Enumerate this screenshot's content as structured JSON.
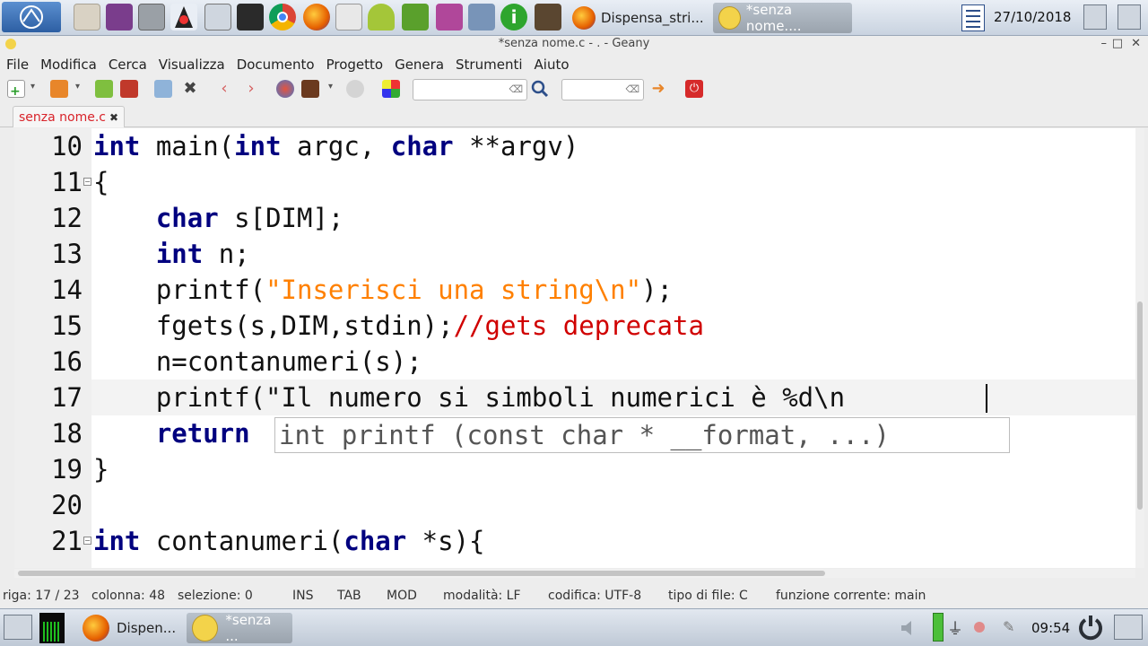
{
  "top_panel": {
    "launchers": [
      "start-menu-icon",
      "files-icon",
      "purple-app-icon",
      "terminal-app-icon",
      "java-icon",
      "camera-icon",
      "screen-icon",
      "chrome-icon",
      "firefox-icon",
      "mail-icon",
      "android-icon",
      "pen-icon",
      "media-icon",
      "network-icon",
      "info-icon",
      "stamp-icon"
    ],
    "tasks": [
      {
        "label": "Dispensa_stri...",
        "icon": "firefox-icon",
        "active": false
      },
      {
        "label": "*senza nome....",
        "icon": "geany-icon",
        "active": true
      }
    ],
    "date": "27/10/2018"
  },
  "window": {
    "title": "*senza nome.c - . - Geany"
  },
  "menu": {
    "items": [
      "File",
      "Modifica",
      "Cerca",
      "Visualizza",
      "Documento",
      "Progetto",
      "Genera",
      "Strumenti",
      "Aiuto"
    ]
  },
  "toolbar": {
    "search_value": "",
    "goto_value": ""
  },
  "tab": {
    "label": "senza nome.c",
    "close": "✖"
  },
  "editor": {
    "lines": [
      {
        "num": "10",
        "fold": "",
        "html": [
          [
            "kw",
            "int"
          ],
          [
            "ph",
            " main("
          ],
          [
            "kw",
            "int"
          ],
          [
            "ph",
            " argc, "
          ],
          [
            "kw",
            "char"
          ],
          [
            "ph",
            " **argv)"
          ]
        ]
      },
      {
        "num": "11",
        "fold": "−",
        "html": [
          [
            "ph",
            "{"
          ]
        ]
      },
      {
        "num": "12",
        "fold": "",
        "html": [
          [
            "ph",
            "    "
          ],
          [
            "kw",
            "char"
          ],
          [
            "ph",
            " s[DIM];"
          ]
        ]
      },
      {
        "num": "13",
        "fold": "",
        "html": [
          [
            "ph",
            "    "
          ],
          [
            "kw",
            "int"
          ],
          [
            "ph",
            " n;"
          ]
        ]
      },
      {
        "num": "14",
        "fold": "",
        "html": [
          [
            "ph",
            "    printf("
          ],
          [
            "str",
            "\"Inserisci una string\\n\""
          ],
          [
            "ph",
            ");"
          ]
        ]
      },
      {
        "num": "15",
        "fold": "",
        "html": [
          [
            "ph",
            "    fgets(s,DIM,stdin);"
          ],
          [
            "cm",
            "//gets deprecata"
          ]
        ]
      },
      {
        "num": "16",
        "fold": "",
        "html": [
          [
            "ph",
            "    n=contanumeri(s);"
          ]
        ]
      },
      {
        "num": "17",
        "fold": "",
        "html": [
          [
            "ph",
            "    printf(\"Il numero si simboli numerici è %d\\n"
          ]
        ]
      },
      {
        "num": "18",
        "fold": "",
        "html": [
          [
            "ph",
            "    "
          ],
          [
            "kw",
            "return"
          ]
        ]
      },
      {
        "num": "19",
        "fold": "",
        "html": [
          [
            "ph",
            "}"
          ]
        ]
      },
      {
        "num": "20",
        "fold": "",
        "html": [
          [
            "ph",
            ""
          ]
        ]
      },
      {
        "num": "21",
        "fold": "−",
        "html": [
          [
            "kw",
            "int"
          ],
          [
            "ph",
            " contanumeri("
          ],
          [
            "kw",
            "char"
          ],
          [
            "ph",
            " *s){"
          ]
        ]
      }
    ],
    "calltip": "int printf (const char * __format, ...)"
  },
  "status": {
    "riga": "riga: 17 / 23",
    "colonna": "colonna: 48",
    "selezione": "selezione: 0",
    "ins": "INS",
    "tab": "TAB",
    "mod": "MOD",
    "modalita": "modalità: LF",
    "codifica": "codifica: UTF-8",
    "tipo": "tipo di file: C",
    "funzione": "funzione corrente: main"
  },
  "bottom_panel": {
    "tasks": [
      {
        "label": "Dispen...",
        "icon": "firefox-icon"
      },
      {
        "label": "*senza ...",
        "icon": "geany-icon"
      }
    ],
    "clock": "09:54"
  },
  "colors": {
    "keyword": "#00007f",
    "string": "#ff8000",
    "comment": "#d00000",
    "tab_label": "#d8232a"
  }
}
